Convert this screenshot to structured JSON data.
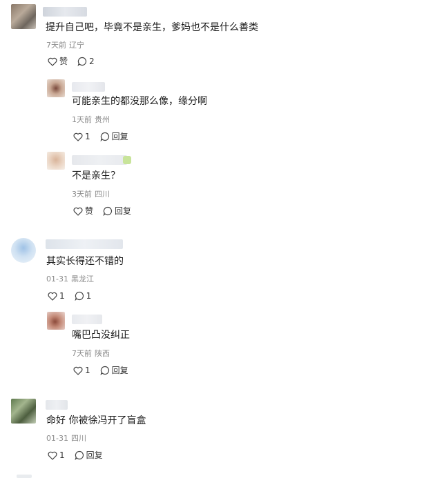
{
  "comments": [
    {
      "text": "提升自己吧，毕竟不是亲生，爹妈也不是什么善类",
      "date": "7天前",
      "location": "辽宁",
      "like_label": "赞",
      "reply_count": "2"
    },
    {
      "text": "可能亲生的都没那么像，缘分啊",
      "date": "1天前",
      "location": "贵州",
      "like_label": "1",
      "reply_label": "回复"
    },
    {
      "text": "不是亲生？",
      "date": "3天前",
      "location": "四川",
      "like_label": "赞",
      "reply_label": "回复"
    },
    {
      "text": "其实长得还不错的",
      "date": "01-31",
      "location": "黑龙江",
      "like_label": "1",
      "reply_count": "1"
    },
    {
      "text": "嘴巴凸没纠正",
      "date": "7天前",
      "location": "陕西",
      "like_label": "1",
      "reply_label": "回复"
    },
    {
      "text": "命好 你被徐冯开了盲盒",
      "date": "01-31",
      "location": "四川",
      "like_label": "1",
      "reply_label": "回复"
    }
  ]
}
